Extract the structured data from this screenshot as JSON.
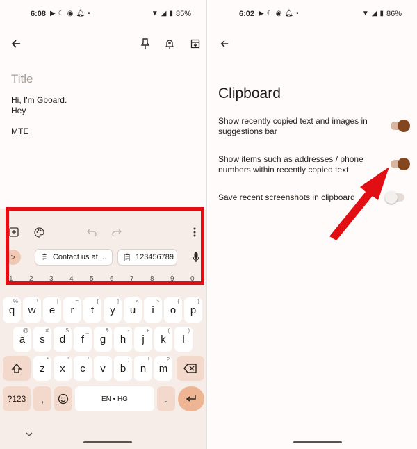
{
  "left": {
    "status": {
      "time": "6:08",
      "battery": "85%"
    },
    "note": {
      "title_placeholder": "Title",
      "line1": "Hi, I'm Gboard.",
      "line2": "Hey",
      "line3": "MTE"
    },
    "clipboard_chips": [
      {
        "text": "Contact us at ..."
      },
      {
        "text": "123456789"
      }
    ],
    "expand_label": ">",
    "number_hints": [
      "1",
      "2",
      "3",
      "4",
      "5",
      "6",
      "7",
      "8",
      "9",
      "0"
    ],
    "row1": [
      {
        "k": "q",
        "h": "%"
      },
      {
        "k": "w",
        "h": "\\"
      },
      {
        "k": "e",
        "h": "|"
      },
      {
        "k": "r",
        "h": "="
      },
      {
        "k": "t",
        "h": "["
      },
      {
        "k": "y",
        "h": "]"
      },
      {
        "k": "u",
        "h": "<"
      },
      {
        "k": "i",
        "h": ">"
      },
      {
        "k": "o",
        "h": "{"
      },
      {
        "k": "p",
        "h": "}"
      }
    ],
    "row2": [
      {
        "k": "a",
        "h": "@"
      },
      {
        "k": "s",
        "h": "#"
      },
      {
        "k": "d",
        "h": "$"
      },
      {
        "k": "f",
        "h": "_"
      },
      {
        "k": "g",
        "h": "&"
      },
      {
        "k": "h",
        "h": "-"
      },
      {
        "k": "j",
        "h": "+"
      },
      {
        "k": "k",
        "h": "("
      },
      {
        "k": "l",
        "h": ")"
      }
    ],
    "row3": [
      {
        "k": "z",
        "h": "*"
      },
      {
        "k": "x",
        "h": "\""
      },
      {
        "k": "c",
        "h": "'"
      },
      {
        "k": "v",
        "h": ":"
      },
      {
        "k": "b",
        "h": ";"
      },
      {
        "k": "n",
        "h": "!"
      },
      {
        "k": "m",
        "h": "?"
      }
    ],
    "bottom": {
      "symbols": "?123",
      "comma": ",",
      "space": "EN • HG",
      "period": "."
    }
  },
  "right": {
    "status": {
      "time": "6:02",
      "battery": "86%"
    },
    "title": "Clipboard",
    "settings": [
      {
        "label": "Show recently copied text and images in suggestions bar",
        "enabled": true
      },
      {
        "label": "Show items such as addresses / phone numbers within recently copied text",
        "enabled": true
      },
      {
        "label": "Save recent screenshots in clipboard",
        "enabled": false
      }
    ]
  },
  "colors": {
    "highlight": "#e10f14",
    "toggle_on": "#84461f",
    "keyboard_bg": "#f7ede8",
    "accent_key": "#eeb595"
  }
}
